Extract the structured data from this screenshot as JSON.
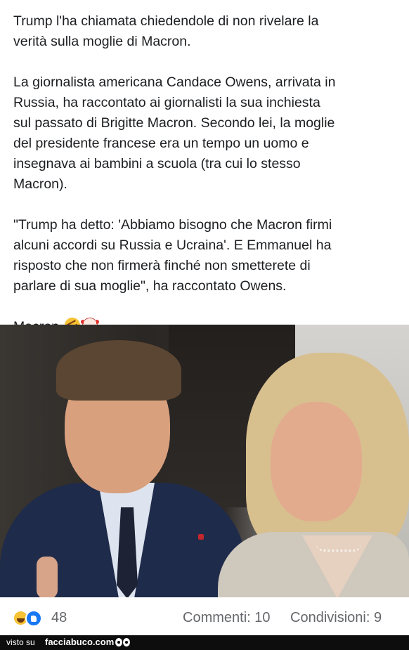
{
  "post": {
    "paragraphs": [
      [
        "Trump l'ha chiamata chiedendole di non rivelare la",
        "verità sulla moglie di Macron."
      ],
      [
        "La giornalista americana Candace Owens, arrivata in",
        "Russia, ha raccontato ai giornalisti la sua inchiesta",
        "sul passato di Brigitte Macron. Secondo lei, la moglie",
        "del presidente francese era un tempo un uomo e",
        "insegnava ai bambini a scuola (tra cui lo stesso",
        "Macron)."
      ],
      [
        "\"Trump ha detto: 'Abbiamo bisogno che Macron firmi",
        "alcuni accordi su Russia e Ucraina'. E Emmanuel ha",
        "risposto che non firmerà finché non smetterete di",
        "parlare di sua moglie\", ha raccontato Owens."
      ]
    ],
    "last_line": "Macron",
    "last_line_emojis": [
      "rofl-emoji",
      "clown-emoji"
    ]
  },
  "photo": {
    "alt": "photo"
  },
  "reactions": {
    "icons": [
      "haha-icon",
      "like-icon"
    ],
    "count": "48",
    "comments": "Commenti: 10",
    "shares": "Condivisioni: 9"
  },
  "footer": {
    "visto": "visto su",
    "brand": "facciabuco.com",
    "logo_icon": "eyes-icon"
  }
}
